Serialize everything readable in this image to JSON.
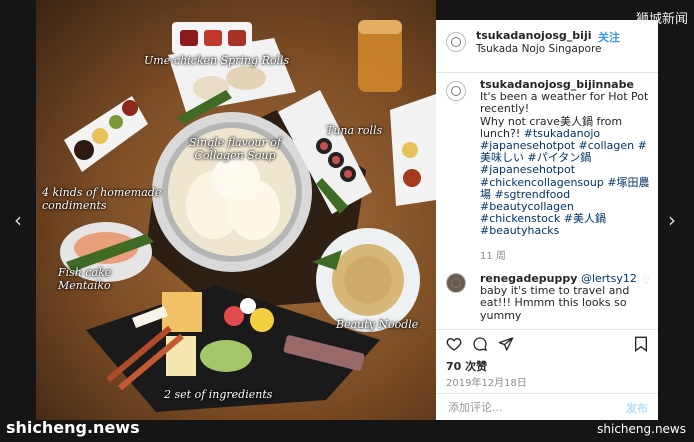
{
  "photo": {
    "captions": {
      "spring_rolls": "Ume-chicken Spring Rolls",
      "soup": "Single flavour of Collagen Soup",
      "tuna": "Tuna rolls",
      "condiments": "4 kinds of homemade condiments",
      "fishcake": "Fish cake Mentaiko",
      "noodle": "Beauty Noodle",
      "ingredients": "2 set of ingredients"
    }
  },
  "post": {
    "username": "tsukadanojosg_bijinnabe",
    "username_header": "tsukadanojosg_biji",
    "follow_label": "关注",
    "location": "Tsukada Nojo Singapore",
    "caption_intro": "It's been a weather for Hot Pot recently!\nWhy not crave美人鍋 from lunch?!",
    "hashtags": "#tsukadanojo #japanesehotpot #collagen #美味しい #パイタン鍋 #japanesehotpot #chickencollagensoup #塚田農場 #sgtrendfood #beautycollagen #chickenstock #美人鍋 #beautyhacks",
    "age": "11 周",
    "comment_user": "renegadepuppy",
    "comment_mention": "@lertsy12",
    "comment_text": "baby it's time to travel and eat!!! Hmmm this looks so yummy",
    "likes": "70 次赞",
    "date": "2019年12月18日",
    "add_comment_placeholder": "添加评论...",
    "post_label": "发布"
  },
  "nav": {
    "prev": "‹",
    "next": "›"
  },
  "watermarks": {
    "top_right": "狮城新闻",
    "bottom_left": "shicheng.news",
    "bottom_right": "shicheng.news"
  },
  "colors": {
    "link": "#003569",
    "accent": "#3897f0",
    "table": "#8a5a2e"
  }
}
